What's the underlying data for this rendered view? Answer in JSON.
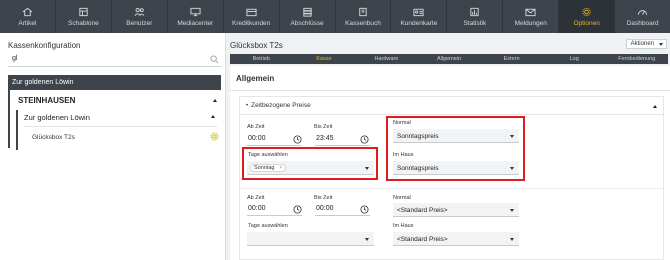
{
  "nav": {
    "items": [
      {
        "label": "Artikel",
        "icon": "home-icon"
      },
      {
        "label": "Schablone",
        "icon": "template-icon"
      },
      {
        "label": "Benutzer",
        "icon": "users-icon"
      },
      {
        "label": "Mediacenter",
        "icon": "monitor-icon"
      },
      {
        "label": "Kreditkunden",
        "icon": "credit-card-icon"
      },
      {
        "label": "Abschlüsse",
        "icon": "stack-icon"
      },
      {
        "label": "Kassenbuch",
        "icon": "book-icon"
      },
      {
        "label": "Kundenkarte",
        "icon": "id-card-icon"
      },
      {
        "label": "Statistik",
        "icon": "bar-chart-icon"
      },
      {
        "label": "Meldungen",
        "icon": "mail-icon"
      },
      {
        "label": "Optionen",
        "icon": "gear-icon"
      },
      {
        "label": "Dashboard",
        "icon": "dashboard-icon"
      }
    ],
    "active_index": 10,
    "active_color": "#e8b320"
  },
  "left": {
    "title": "Kassenkonfiguration",
    "search_value": "gl",
    "tree_header": "Zur goldenen Löwin",
    "level1": "STEINHAUSEN",
    "level2": "Zur goldenen Löwin",
    "level3": "Glücksbox T2s"
  },
  "right": {
    "title": "Glücksbox T2s",
    "actions_label": "Aktionen",
    "tabs": [
      "Betrieb",
      "Kasse",
      "Hardware",
      "Allgemein",
      "Extern",
      "Log",
      "Fernbedienung"
    ],
    "active_tab": "Kasse",
    "section_title": "Allgemein",
    "card_title": "Zeitbezogene Preise",
    "rule1": {
      "from_label": "Ab Zeit",
      "from_value": "00:00",
      "to_label": "Bis Zeit",
      "to_value": "23:45",
      "days_label": "Tage auswählen",
      "day_chip": "Sonntag",
      "normal_label": "Normal",
      "normal_value": "Sonntagspreis",
      "inhouse_label": "Im Haus",
      "inhouse_value": "Sonntagspreis"
    },
    "rule2": {
      "from_label": "Ab Zeit",
      "from_value": "00:00",
      "to_label": "Bis Zeit",
      "to_value": "00:00",
      "days_label": "Tage auswählen",
      "normal_label": "Normal",
      "normal_value": "<Standard Preis>",
      "inhouse_label": "Im Haus",
      "inhouse_value": "<Standard Preis>"
    },
    "highlight_color": "#e01b1b"
  }
}
